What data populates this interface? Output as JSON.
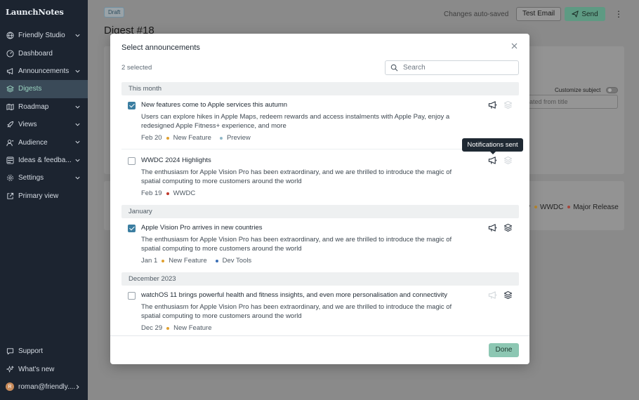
{
  "brand": "LaunchNotes",
  "sidebar": {
    "items": [
      {
        "label": "Friendly Studio",
        "icon": "globe-icon",
        "chevron": true
      },
      {
        "label": "Dashboard",
        "icon": "dashboard-icon",
        "chevron": false
      },
      {
        "label": "Announcements",
        "icon": "megaphone-icon",
        "chevron": true
      },
      {
        "label": "Digests",
        "icon": "layers-icon",
        "chevron": false,
        "active": true
      },
      {
        "label": "Roadmap",
        "icon": "map-icon",
        "chevron": true
      },
      {
        "label": "Views",
        "icon": "rocket-icon",
        "chevron": true
      },
      {
        "label": "Audience",
        "icon": "user-icon",
        "chevron": true
      },
      {
        "label": "Ideas & feedba...",
        "icon": "ideas-icon",
        "chevron": true
      },
      {
        "label": "Settings",
        "icon": "gear-icon",
        "chevron": true
      },
      {
        "label": "Primary view",
        "icon": "external-link-icon",
        "chevron": false
      }
    ],
    "bottom": [
      {
        "label": "Support",
        "icon": "chat-icon"
      },
      {
        "label": "What's new",
        "icon": "sparkle-icon"
      },
      {
        "label": "roman@friendly....",
        "avatar": "R"
      }
    ]
  },
  "page": {
    "draft_badge": "Draft",
    "title": "Digest #18",
    "autosaved": "Changes auto-saved",
    "test_email": "Test Email",
    "send": "Send",
    "customize_subject": "Customize subject",
    "subject_placeholder": "ated from title",
    "tags_fragment": "v",
    "tags": [
      {
        "label": "WWDC",
        "color": "#b8862a"
      },
      {
        "label": "Major Release",
        "color": "#a8453a"
      }
    ]
  },
  "modal": {
    "title": "Select announcements",
    "selected_count": "2 selected",
    "search_placeholder": "Search",
    "tooltip": "Notifications sent",
    "done": "Done",
    "sections": [
      {
        "label": "This month",
        "items": [
          {
            "checked": true,
            "title": "New features come to Apple services this autumn",
            "description": "Users can explore hikes in Apple Maps, redeem rewards and access instalments with Apple Pay, enjoy a redesigned Apple Fitness+ experience, and more",
            "date": "Feb 20",
            "tags": [
              {
                "label": "New Feature",
                "color": "#e0a030"
              },
              {
                "label": "Preview",
                "color": "#8fb8c8"
              }
            ],
            "notify_active": true,
            "layers_active": false
          },
          {
            "checked": false,
            "title": "WWDC 2024 Highlights",
            "description": "The enthusiasm for Apple Vision Pro has been extraordinary, and we are thrilled to introduce the magic of spatial computing to more customers around the world",
            "date": "Feb 19",
            "tags": [
              {
                "label": "WWDC",
                "color": "#c0392b"
              }
            ],
            "notify_active": true,
            "layers_active": false
          }
        ]
      },
      {
        "label": "January",
        "items": [
          {
            "checked": true,
            "title": "Apple Vision Pro arrives in new countries",
            "description": "The enthusiasm for Apple Vision Pro has been extraordinary, and we are thrilled to introduce the magic of spatial computing to more customers around the world",
            "date": "Jan 1",
            "tags": [
              {
                "label": "New Feature",
                "color": "#e0a030"
              },
              {
                "label": "Dev Tools",
                "color": "#3b6fb6"
              }
            ],
            "notify_active": true,
            "layers_active": true
          }
        ]
      },
      {
        "label": "December 2023",
        "items": [
          {
            "checked": false,
            "title": "watchOS 11 brings powerful health and fitness insights, and even more personalisation and connectivity",
            "description": "The enthusiasm for Apple Vision Pro has been extraordinary, and we are thrilled to introduce the magic of spatial computing to more customers around the world",
            "date": "Dec 29",
            "tags": [
              {
                "label": "New Feature",
                "color": "#e0a030"
              }
            ],
            "notify_active": false,
            "layers_active": true
          }
        ]
      }
    ]
  }
}
